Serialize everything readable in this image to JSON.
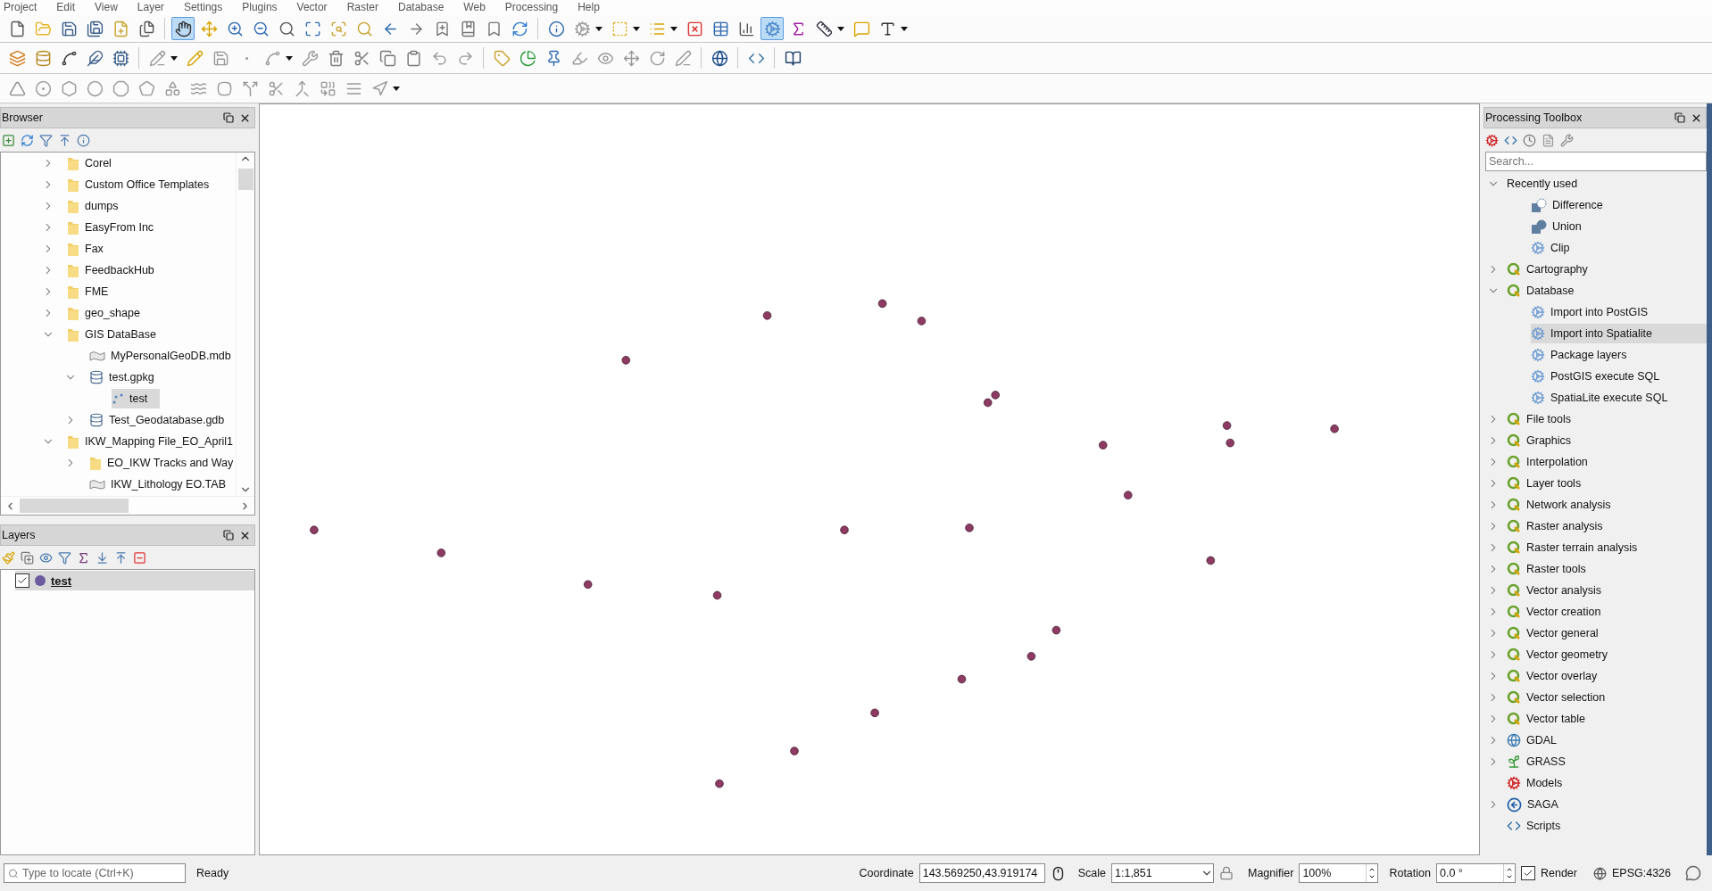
{
  "menu": [
    "Project",
    "Edit",
    "View",
    "Layer",
    "Settings",
    "Plugins",
    "Vector",
    "Raster",
    "Database",
    "Web",
    "Processing",
    "Help"
  ],
  "toolbars": [
    {
      "items": [
        {
          "kind": "new",
          "selected": false
        },
        {
          "kind": "open",
          "selected": false
        },
        {
          "kind": "save",
          "selected": false
        },
        {
          "kind": "save-as",
          "selected": false
        },
        {
          "kind": "new-layout",
          "selected": false
        },
        {
          "kind": "layout-manager",
          "selected": false
        },
        {
          "kind": "sep"
        },
        {
          "kind": "pan",
          "selected": true
        },
        {
          "kind": "pan-selection",
          "selected": false
        },
        {
          "kind": "zoom-in",
          "selected": false
        },
        {
          "kind": "zoom-out",
          "selected": false
        },
        {
          "kind": "zoom-native",
          "selected": false
        },
        {
          "kind": "zoom-full",
          "selected": false
        },
        {
          "kind": "zoom-selection",
          "selected": false
        },
        {
          "kind": "zoom-layer",
          "selected": false
        },
        {
          "kind": "zoom-last",
          "selected": false
        },
        {
          "kind": "zoom-next",
          "selected": false
        },
        {
          "kind": "new-bookmark",
          "selected": false
        },
        {
          "kind": "show-bookmarks",
          "selected": false
        },
        {
          "kind": "bookmark",
          "selected": false
        },
        {
          "kind": "refresh",
          "selected": false
        },
        {
          "kind": "sep"
        },
        {
          "kind": "identify",
          "selected": false
        },
        {
          "kind": "action",
          "selected": false,
          "dropdown": true
        },
        {
          "kind": "select",
          "selected": false,
          "dropdown": true
        },
        {
          "kind": "select-by-value",
          "selected": false,
          "dropdown": true
        },
        {
          "kind": "deselect",
          "selected": false
        },
        {
          "kind": "attribute-table",
          "selected": false
        },
        {
          "kind": "statistics",
          "selected": false
        },
        {
          "kind": "toolbox",
          "selected": true
        },
        {
          "kind": "sum",
          "selected": false
        },
        {
          "kind": "measure",
          "selected": false,
          "dropdown": true
        },
        {
          "kind": "annotation",
          "selected": false
        },
        {
          "kind": "text-annotation",
          "selected": false,
          "dropdown": true
        }
      ]
    },
    {
      "items": [
        {
          "kind": "data-source"
        },
        {
          "kind": "new-geopackage"
        },
        {
          "kind": "new-shapefile"
        },
        {
          "kind": "new-scratch"
        },
        {
          "kind": "new-virtual"
        },
        {
          "kind": "sep"
        },
        {
          "kind": "current-edits",
          "dropdown": true
        },
        {
          "kind": "toggle-edit"
        },
        {
          "kind": "save-edits"
        },
        {
          "kind": "add-point"
        },
        {
          "kind": "vertex-tool",
          "dropdown": true
        },
        {
          "kind": "modify-attributes"
        },
        {
          "kind": "delete"
        },
        {
          "kind": "cut"
        },
        {
          "kind": "copy"
        },
        {
          "kind": "paste"
        },
        {
          "kind": "undo"
        },
        {
          "kind": "redo"
        },
        {
          "kind": "sep"
        },
        {
          "kind": "label"
        },
        {
          "kind": "diagram"
        },
        {
          "kind": "pin-label"
        },
        {
          "kind": "highlight-label"
        },
        {
          "kind": "show-label"
        },
        {
          "kind": "move-label"
        },
        {
          "kind": "rotate-label"
        },
        {
          "kind": "change-label"
        },
        {
          "kind": "sep"
        },
        {
          "kind": "globe"
        },
        {
          "kind": "sep"
        },
        {
          "kind": "python"
        },
        {
          "kind": "sep"
        },
        {
          "kind": "help"
        }
      ]
    },
    {
      "items": [
        {
          "kind": "advanced-digitizing"
        },
        {
          "kind": "add-ring"
        },
        {
          "kind": "add-part"
        },
        {
          "kind": "fill-ring"
        },
        {
          "kind": "delete-ring"
        },
        {
          "kind": "delete-part"
        },
        {
          "kind": "reshape"
        },
        {
          "kind": "offset-curve"
        },
        {
          "kind": "simplify"
        },
        {
          "kind": "split-features"
        },
        {
          "kind": "split-parts"
        },
        {
          "kind": "merge"
        },
        {
          "kind": "merge-attributes"
        },
        {
          "kind": "align"
        },
        {
          "kind": "rotate-point",
          "dropdown": true
        }
      ]
    }
  ],
  "browser": {
    "title": "Browser",
    "items": [
      {
        "label": "Corel",
        "kind": "folder",
        "expanded": false,
        "selected": false
      },
      {
        "label": "Custom Office Templates",
        "kind": "folder",
        "expanded": false,
        "selected": false
      },
      {
        "label": "dumps",
        "kind": "folder",
        "expanded": false,
        "selected": false
      },
      {
        "label": "EasyFrom Inc",
        "kind": "folder",
        "expanded": false,
        "selected": false
      },
      {
        "label": "Fax",
        "kind": "folder",
        "expanded": false,
        "selected": false
      },
      {
        "label": "FeedbackHub",
        "kind": "folder",
        "expanded": false,
        "selected": false
      },
      {
        "label": "FME",
        "kind": "folder",
        "expanded": false,
        "selected": false
      },
      {
        "label": "geo_shape",
        "kind": "folder",
        "expanded": false,
        "selected": false
      },
      {
        "label": "GIS DataBase",
        "kind": "folder",
        "expanded": true,
        "selected": false,
        "children": [
          {
            "label": "MyPersonalGeoDB.mdb",
            "kind": "dataset",
            "selected": false
          },
          {
            "label": "test.gpkg",
            "kind": "database",
            "expanded": true,
            "selected": false,
            "children": [
              {
                "label": "test",
                "kind": "points",
                "selected": true
              }
            ]
          },
          {
            "label": "Test_Geodatabase.gdb",
            "kind": "database",
            "expanded": false,
            "selected": false
          }
        ]
      },
      {
        "label": "IKW_Mapping File_EO_April1",
        "kind": "folder",
        "expanded": true,
        "selected": false,
        "children": [
          {
            "label": "EO_IKW Tracks and Way",
            "kind": "folder",
            "expanded": false,
            "selected": false
          },
          {
            "label": "IKW_Lithology EO.TAB",
            "kind": "dataset",
            "selected": false
          }
        ]
      }
    ]
  },
  "layers": {
    "title": "Layers",
    "items": [
      {
        "label": "test",
        "checked": true,
        "selected": true
      }
    ]
  },
  "toolbox": {
    "title": "Processing Toolbox",
    "search": {
      "placeholder": "Search..."
    },
    "items": [
      {
        "label": "Recently used",
        "kind": "group",
        "expanded": true,
        "selected": false,
        "children": [
          {
            "label": "Difference",
            "kind": "difference",
            "selected": false
          },
          {
            "label": "Union",
            "kind": "union",
            "selected": false
          },
          {
            "label": "Clip",
            "kind": "algorithm",
            "selected": false
          }
        ]
      },
      {
        "label": "Cartography",
        "kind": "qgis",
        "expanded": false,
        "selected": false
      },
      {
        "label": "Database",
        "kind": "qgis",
        "expanded": true,
        "selected": false,
        "children": [
          {
            "label": "Import into PostGIS",
            "kind": "algorithm",
            "selected": false
          },
          {
            "label": "Import into Spatialite",
            "kind": "algorithm",
            "selected": true
          },
          {
            "label": "Package layers",
            "kind": "algorithm",
            "selected": false
          },
          {
            "label": "PostGIS execute SQL",
            "kind": "algorithm",
            "selected": false
          },
          {
            "label": "SpatiaLite execute SQL",
            "kind": "algorithm",
            "selected": false
          }
        ]
      },
      {
        "label": "File tools",
        "kind": "qgis",
        "expanded": false,
        "selected": false
      },
      {
        "label": "Graphics",
        "kind": "qgis",
        "expanded": false,
        "selected": false
      },
      {
        "label": "Interpolation",
        "kind": "qgis",
        "expanded": false,
        "selected": false
      },
      {
        "label": "Layer tools",
        "kind": "qgis",
        "expanded": false,
        "selected": false
      },
      {
        "label": "Network analysis",
        "kind": "qgis",
        "expanded": false,
        "selected": false
      },
      {
        "label": "Raster analysis",
        "kind": "qgis",
        "expanded": false,
        "selected": false
      },
      {
        "label": "Raster terrain analysis",
        "kind": "qgis",
        "expanded": false,
        "selected": false
      },
      {
        "label": "Raster tools",
        "kind": "qgis",
        "expanded": false,
        "selected": false
      },
      {
        "label": "Vector analysis",
        "kind": "qgis",
        "expanded": false,
        "selected": false
      },
      {
        "label": "Vector creation",
        "kind": "qgis",
        "expanded": false,
        "selected": false
      },
      {
        "label": "Vector general",
        "kind": "qgis",
        "expanded": false,
        "selected": false
      },
      {
        "label": "Vector geometry",
        "kind": "qgis",
        "expanded": false,
        "selected": false
      },
      {
        "label": "Vector overlay",
        "kind": "qgis",
        "expanded": false,
        "selected": false
      },
      {
        "label": "Vector selection",
        "kind": "qgis",
        "expanded": false,
        "selected": false
      },
      {
        "label": "Vector table",
        "kind": "qgis",
        "expanded": false,
        "selected": false
      },
      {
        "label": "GDAL",
        "kind": "gdal",
        "expanded": false,
        "selected": false
      },
      {
        "label": "GRASS",
        "kind": "grass",
        "expanded": false,
        "selected": false
      },
      {
        "label": "Models",
        "kind": "models",
        "selected": false
      },
      {
        "label": "SAGA",
        "kind": "saga",
        "expanded": false,
        "selected": false
      },
      {
        "label": "Scripts",
        "kind": "scripts",
        "selected": false
      }
    ]
  },
  "status_bar": {
    "locator": {
      "placeholder": "Type to locate (Ctrl+K)"
    },
    "message": "Ready",
    "coordinate": {
      "label": "Coordinate",
      "value": "143.569250,43.919174"
    },
    "scale": {
      "label": "Scale",
      "value": "1:1,851"
    },
    "magnifier": {
      "label": "Magnifier",
      "value": "100%"
    },
    "rotation": {
      "label": "Rotation",
      "value": "0.0 °"
    },
    "render": {
      "label": "Render",
      "checked": true
    },
    "crs": "EPSG:4326"
  }
}
